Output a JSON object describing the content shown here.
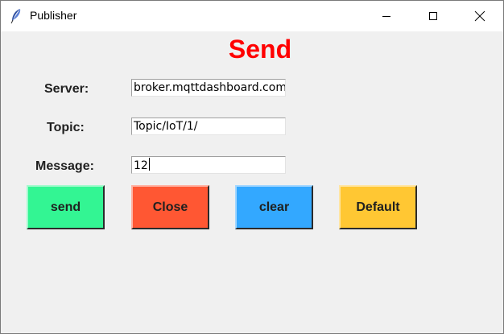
{
  "window": {
    "title": "Publisher"
  },
  "titlebar": {
    "icons": [
      "feather-icon",
      "minimize-icon",
      "maximize-icon",
      "close-icon"
    ]
  },
  "heading": {
    "text": "Send",
    "color": "#ff0000"
  },
  "form": {
    "server": {
      "label": "Server:",
      "value": "broker.mqttdashboard.com"
    },
    "topic": {
      "label": "Topic:",
      "value": "Topic/IoT/1/"
    },
    "message": {
      "label": "Message:",
      "value": "12"
    }
  },
  "buttons": {
    "send": {
      "label": "send",
      "color": "#33f593"
    },
    "close": {
      "label": "Close",
      "color": "#ff5733"
    },
    "clear": {
      "label": "clear",
      "color": "#33a8ff"
    },
    "default": {
      "label": "Default",
      "color": "#ffc733"
    }
  }
}
